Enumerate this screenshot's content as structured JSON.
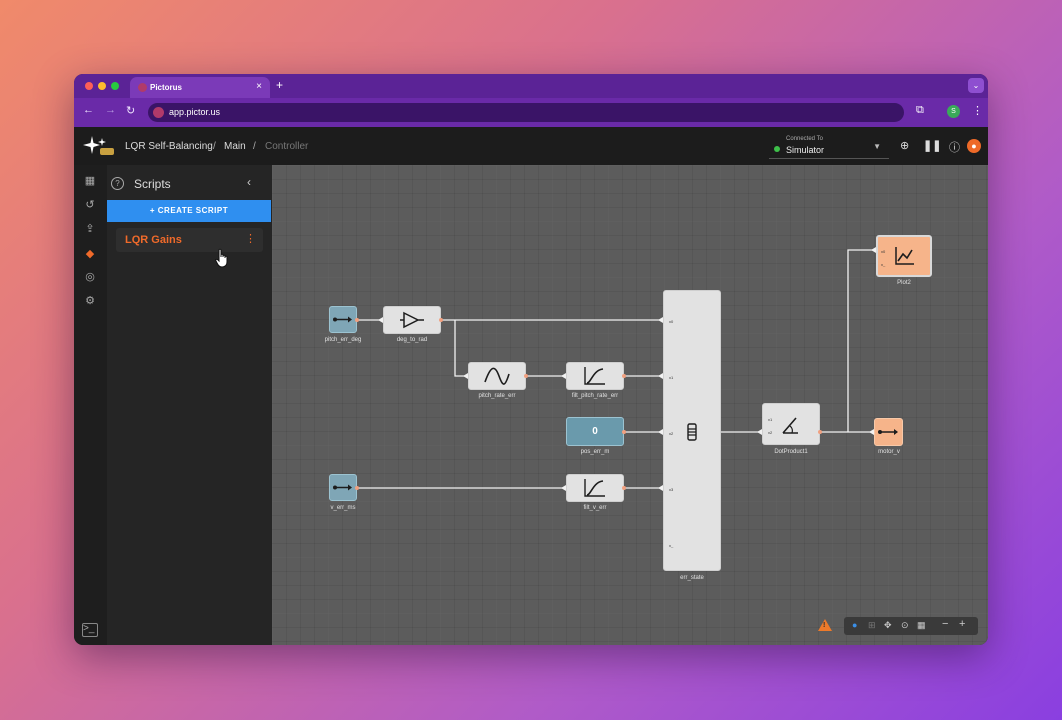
{
  "browser": {
    "tab_title": "Pictorus",
    "tab_close": "×",
    "new_tab": "+",
    "url": "app.pictor.us",
    "profile_initial": "S"
  },
  "app": {
    "breadcrumbs": [
      "LQR Self-Balancing",
      "Main",
      "Controller"
    ],
    "separator": "/",
    "connection_label": "Connected To",
    "connection_value": "Simulator"
  },
  "scripts_panel": {
    "title": "Scripts",
    "create_label": "+ CREATE SCRIPT",
    "items": [
      {
        "name": "LQR Gains"
      }
    ]
  },
  "canvas": {
    "blocks": [
      {
        "id": "pitch_err_deg",
        "label": "pitch_err_deg"
      },
      {
        "id": "deg_to_rad",
        "label": "deg_to_rad"
      },
      {
        "id": "pitch_rate_err",
        "label": "pitch_rate_err"
      },
      {
        "id": "filt_pitch_rate_err",
        "label": "filt_pitch_rate_err"
      },
      {
        "id": "pos_err_m",
        "label": "pos_err_m",
        "value": "0"
      },
      {
        "id": "v_err_ms",
        "label": "v_err_ms"
      },
      {
        "id": "filt_v_err",
        "label": "filt_v_err"
      },
      {
        "id": "err_state",
        "label": "err_state"
      },
      {
        "id": "DotProduct1",
        "label": "DotProduct1"
      },
      {
        "id": "motor_v",
        "label": "motor_v"
      },
      {
        "id": "Plot2",
        "label": "Plot2"
      }
    ],
    "mux_inputs": [
      "x0",
      "x1",
      "x2",
      "x3",
      "x_"
    ],
    "dot_inputs": [
      "v1",
      "v2"
    ],
    "plot_inputs": [
      "x0",
      "x_"
    ]
  },
  "colors": {
    "accent": "#2f8ff0",
    "script_name": "#f06a2a",
    "connected": "#3ec04a",
    "browser_tabbar": "#5b2396"
  }
}
